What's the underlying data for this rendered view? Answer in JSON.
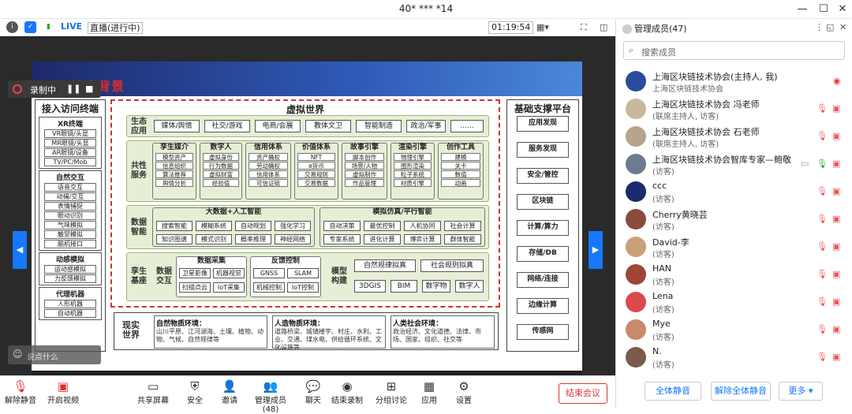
{
  "window": {
    "title": "40* *** *14"
  },
  "topbar": {
    "live": "LIVE",
    "stream_status": "直播(进行中)",
    "timer": "01:19:54"
  },
  "recording": {
    "status": "录制中"
  },
  "slide": {
    "title": "技术背景",
    "access": {
      "title": "接入访问终端",
      "groups": [
        {
          "title": "XR终端",
          "items": [
            "VR眼镜/头显",
            "MR眼镜/头显",
            "AR眼镜/设备",
            "TV/PC/Mob"
          ]
        },
        {
          "title": "自然交互",
          "items": [
            "语音交互",
            "动捕/交互",
            "表情捕捉",
            "眼动识别",
            "气味模拟",
            "触觉模拟",
            "脑机接口"
          ]
        },
        {
          "title": "动感模拟",
          "items": [
            "运动感模拟",
            "力反馈模拟"
          ]
        },
        {
          "title": "代理机器",
          "items": [
            "人形机器",
            "自动机器"
          ]
        }
      ]
    },
    "virtual": {
      "title": "虚拟世界",
      "eco": {
        "label": "生态应用",
        "items": [
          "媒体/舆情",
          "社交/游戏",
          "电商/会展",
          "教体文卫",
          "智能制造",
          "政治/军事",
          "......"
        ]
      },
      "shared": {
        "label": "共性服务",
        "blocks": [
          {
            "title": "孪生媒介",
            "items": [
              "模型资产",
              "信息组织",
              "算法推荐",
              "舆情分析"
            ]
          },
          {
            "title": "数字人",
            "items": [
              "虚拟身份",
              "行为数据",
              "虚拟财富",
              "经验值"
            ]
          },
          {
            "title": "信用体系",
            "items": [
              "资产确权",
              "劳动确权",
              "信用体系",
              "可信证链"
            ]
          },
          {
            "title": "价值体系",
            "items": [
              "NFT",
              "e货币",
              "交易规则",
              "交易数据"
            ]
          },
          {
            "title": "故事引擎",
            "items": [
              "脚本创作",
              "场景/人物",
              "虚拟制作",
              "作品管理"
            ]
          },
          {
            "title": "渲染引擎",
            "items": [
              "物理引擎",
              "图形渲染",
              "粒子系统",
              "材质引擎"
            ]
          },
          {
            "title": "创作工具",
            "items": [
              "建模",
              "关卡",
              "数值",
              "动画"
            ]
          }
        ]
      },
      "intel": {
        "label": "数据智能",
        "ai": {
          "title": "大数据+人工智能",
          "row1": [
            "搜索智能",
            "模糊系统",
            "自动规划",
            "强化学习"
          ],
          "row2": [
            "知识图谱",
            "模式识别",
            "概率推理",
            "神经网络"
          ]
        },
        "sim": {
          "title": "模拟仿真/平行智能",
          "row1": [
            "自动决策",
            "最优控制",
            "人机协同",
            "社会计算"
          ],
          "row2": [
            "专家系统",
            "进化计算",
            "博弈计算",
            "群体智能"
          ]
        }
      },
      "twin": {
        "label": "孪生基座",
        "data_label": "数据交互",
        "collect": {
          "title": "数据采集",
          "items": [
            "卫星影像",
            "机器视觉",
            "扫描点云",
            "IoT采集"
          ]
        },
        "feedback": {
          "title": "反馈控制",
          "items": [
            "GNSS",
            "SLAM",
            "机械控制",
            "IoT控制"
          ]
        },
        "model_label": "模型构建",
        "models": [
          "自然规律拟真",
          "社会规则拟真",
          "3DGIS",
          "BIM",
          "数字物",
          "数字人"
        ]
      }
    },
    "real": {
      "title": "现实世界",
      "boxes": [
        {
          "title": "自然物质环境：",
          "text": "山川平原、江河湖海、土壤、植物、动物、气候、自然规律等"
        },
        {
          "title": "人造物质环境：",
          "text": "道路桥梁、城镇楼宇、村庄、水利、工业、交通、煤水电、供给循环系统、文化设施等"
        },
        {
          "title": "人类社会环境：",
          "text": "政治经济、文化道德、法律、市场、国家、组织、社交等"
        }
      ]
    },
    "infra": {
      "title": "基础支撑平台",
      "items": [
        "应用发现",
        "服务发现",
        "安全/管控",
        "区块链",
        "计算/算力",
        "存储/DB",
        "网络/连接",
        "边缘计算",
        "传感网"
      ]
    }
  },
  "comment": {
    "placeholder": "说点什么"
  },
  "toolbar": {
    "items": [
      "解除静音",
      "开启视频",
      "共享屏幕",
      "安全",
      "邀请",
      "管理成员(48)",
      "聊天",
      "结束录制",
      "分组讨论",
      "应用",
      "设置"
    ],
    "end": "结束会议"
  },
  "panel": {
    "title": "管理成员(47)",
    "search_placeholder": "搜索成员",
    "members": [
      {
        "name": "上海区块链技术协会(主持人, 我)",
        "role": "上海区块链技术协会"
      },
      {
        "name": "上海区块链技术协会 冯老师",
        "role": "(联席主持人, 访客)"
      },
      {
        "name": "上海区块链技术协会 石老师",
        "role": "(联席主持人, 访客)"
      },
      {
        "name": "上海区块链技术协会智库专家—鲍敬",
        "role": "(访客)"
      },
      {
        "name": "ccc",
        "role": "(访客)"
      },
      {
        "name": "Cherry黄晓芸",
        "role": "(访客)"
      },
      {
        "name": "David-李",
        "role": "(访客)"
      },
      {
        "name": "HAN",
        "role": "(访客)"
      },
      {
        "name": "Lena",
        "role": "(访客)"
      },
      {
        "name": "Mye",
        "role": "(访客)"
      },
      {
        "name": "N.",
        "role": "(访客)"
      }
    ],
    "btn_mute_all": "全体静音",
    "btn_unmute_all": "解除全体静音",
    "btn_more": "更多"
  }
}
